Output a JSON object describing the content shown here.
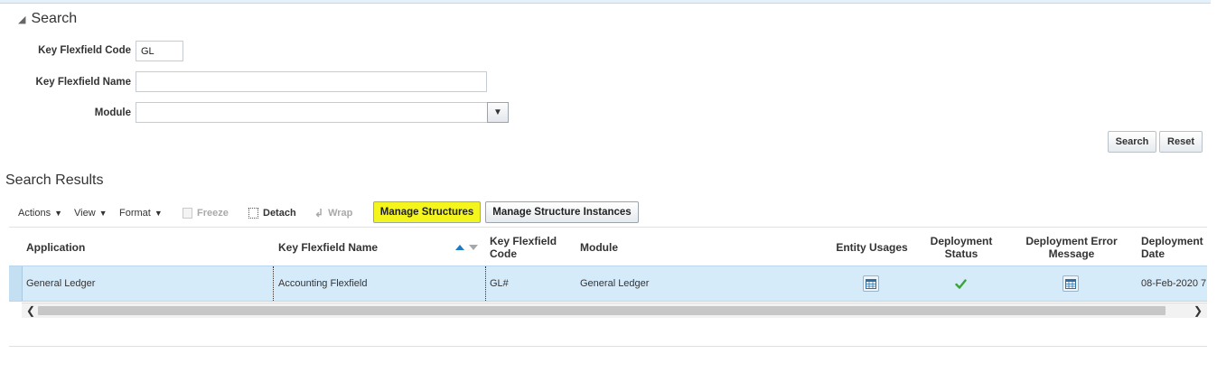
{
  "search": {
    "title": "Search",
    "fields": {
      "code_label": "Key Flexfield Code",
      "code_value": "GL",
      "name_label": "Key Flexfield Name",
      "name_value": "",
      "module_label": "Module",
      "module_value": ""
    },
    "search_button": "Search",
    "reset_button": "Reset"
  },
  "results": {
    "title": "Search Results",
    "toolbar": {
      "actions": "Actions",
      "view": "View",
      "format": "Format",
      "freeze": "Freeze",
      "detach": "Detach",
      "wrap": "Wrap",
      "manage_structures": "Manage Structures",
      "manage_structure_instances": "Manage Structure Instances"
    },
    "columns": {
      "application": "Application",
      "kff_name": "Key Flexfield Name",
      "kff_code_1": "Key Flexfield",
      "kff_code_2": "Code",
      "module": "Module",
      "entity_usages": "Entity Usages",
      "deploy_status_1": "Deployment",
      "deploy_status_2": "Status",
      "deploy_error_1": "Deployment Error",
      "deploy_error_2": "Message",
      "deploy_date_1": "Deployment",
      "deploy_date_2": "Date"
    },
    "rows": [
      {
        "application": "General Ledger",
        "kff_name": "Accounting Flexfield",
        "kff_code": "GL#",
        "module": "General Ledger",
        "deployment_date": "08-Feb-2020 7:"
      }
    ]
  },
  "colors": {
    "highlight": "#f5f51e",
    "row_selected": "#d6ebfa",
    "sort_active": "#1f7bc2",
    "status_ok": "#3aa33a"
  }
}
